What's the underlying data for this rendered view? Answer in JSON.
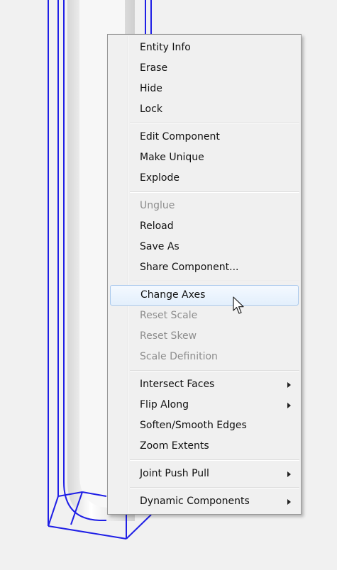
{
  "menu": {
    "groups": [
      [
        {
          "label": "Entity Info",
          "enabled": true
        },
        {
          "label": "Erase",
          "enabled": true
        },
        {
          "label": "Hide",
          "enabled": true
        },
        {
          "label": "Lock",
          "enabled": true
        }
      ],
      [
        {
          "label": "Edit Component",
          "enabled": true
        },
        {
          "label": "Make Unique",
          "enabled": true
        },
        {
          "label": "Explode",
          "enabled": true
        }
      ],
      [
        {
          "label": "Unglue",
          "enabled": false
        },
        {
          "label": "Reload",
          "enabled": true
        },
        {
          "label": "Save As",
          "enabled": true
        },
        {
          "label": "Share Component...",
          "enabled": true
        }
      ],
      [
        {
          "label": "Change Axes",
          "enabled": true,
          "highlighted": true
        },
        {
          "label": "Reset Scale",
          "enabled": false
        },
        {
          "label": "Reset Skew",
          "enabled": false
        },
        {
          "label": "Scale Definition",
          "enabled": false
        }
      ],
      [
        {
          "label": "Intersect Faces",
          "enabled": true,
          "submenu": true
        },
        {
          "label": "Flip Along",
          "enabled": true,
          "submenu": true
        },
        {
          "label": "Soften/Smooth Edges",
          "enabled": true
        },
        {
          "label": "Zoom Extents",
          "enabled": true
        }
      ],
      [
        {
          "label": "Joint Push Pull",
          "enabled": true,
          "submenu": true
        }
      ],
      [
        {
          "label": "Dynamic Components",
          "enabled": true,
          "submenu": true
        }
      ]
    ]
  },
  "icons": {
    "cursor": "mouse-pointer-icon",
    "submenu": "submenu-arrow-icon"
  },
  "colors": {
    "edge_blue": "#1f1fe6",
    "menu_bg": "#f0f0f0",
    "highlight_border": "#a8c8ec",
    "disabled_text": "#8d8d8d"
  }
}
